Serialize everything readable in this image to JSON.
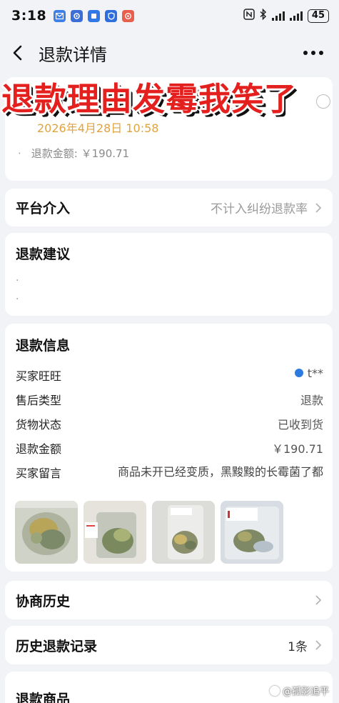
{
  "status_bar": {
    "time": "3:18",
    "battery": "45",
    "app_icons": [
      {
        "name": "mail-app-icon",
        "color": "#3f7fe8"
      },
      {
        "name": "settings-app-icon",
        "color": "#3b6fd6"
      },
      {
        "name": "message-app-icon",
        "color": "#2f78e6"
      },
      {
        "name": "shield-app-icon",
        "color": "#2d6fdc"
      },
      {
        "name": "gallery-app-icon",
        "color": "#e8604d"
      }
    ]
  },
  "nav": {
    "title": "退款详情"
  },
  "overlay": {
    "headline": "退款理由发霉我笑了",
    "date": "2026年4月28日 10:58"
  },
  "top_card": {
    "refund_amount_line": "退款金额: ￥190.71"
  },
  "platform": {
    "title": "平台介入",
    "value": "不计入纠纷退款率"
  },
  "advice": {
    "title": "退款建议",
    "bullets": [
      "·",
      "·"
    ]
  },
  "info": {
    "title": "退款信息",
    "rows": [
      {
        "label": "买家旺旺",
        "value": "t**"
      },
      {
        "label": "售后类型",
        "value": "退款"
      },
      {
        "label": "货物状态",
        "value": "已收到货"
      },
      {
        "label": "退款金额",
        "value": "￥190.71"
      },
      {
        "label": "买家留言",
        "value": "商品未开已经变质，黑黢黢的长霉菌了都"
      }
    ],
    "photo_count": 4
  },
  "history": {
    "title": "协商历史"
  },
  "records": {
    "title": "历史退款记录",
    "count": "1条"
  },
  "products": {
    "title": "退款商品"
  },
  "watermark": {
    "text": "@孤影追平"
  },
  "colors": {
    "accent_red": "#e3201e",
    "date_gold": "#e0a341",
    "background": "#f1f3f6"
  }
}
